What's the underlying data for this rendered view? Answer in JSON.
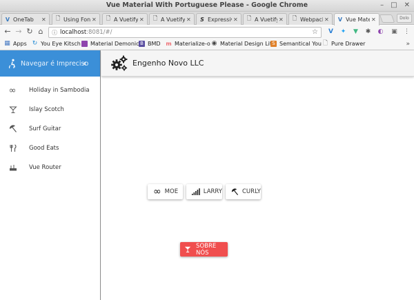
{
  "window": {
    "title": "Vue Material With Portuguese Please - Google Chrome",
    "controls": [
      "–",
      "□",
      "✕"
    ]
  },
  "tabs": [
    {
      "label": "OneTab",
      "icon": "onetab-icon",
      "glyph": "V",
      "color": "#3b7bbf",
      "active": false
    },
    {
      "label": "Using Fon",
      "icon": "page-icon",
      "glyph": "🗋",
      "color": "#666666",
      "active": false
    },
    {
      "label": "A Vuetify T",
      "icon": "page-icon",
      "glyph": "🗋",
      "color": "#666666",
      "active": false
    },
    {
      "label": "A Vuetify T",
      "icon": "page-icon",
      "glyph": "🗋",
      "color": "#666666",
      "active": false
    },
    {
      "label": "Expressiv",
      "icon": "s-logo-icon",
      "glyph": "𝑆",
      "color": "#333333",
      "active": false
    },
    {
      "label": "A Vuetify T",
      "icon": "page-icon",
      "glyph": "🗋",
      "color": "#666666",
      "active": false
    },
    {
      "label": "Webpack",
      "icon": "page-icon",
      "glyph": "🗋",
      "color": "#666666",
      "active": false
    },
    {
      "label": "Vue Mater",
      "icon": "vue-icon",
      "glyph": "V",
      "color": "#3b7bbf",
      "active": true
    }
  ],
  "profile_label": "Dolo",
  "address": {
    "host": "localhost",
    "rest": ":8081/#/"
  },
  "extensions": [
    {
      "name": "vue-devtools-icon",
      "glyph": "V",
      "color": "#2a7fd4"
    },
    {
      "name": "twitter-icon",
      "glyph": "🐦",
      "color": "#1da1f2"
    },
    {
      "name": "vue-logo-icon",
      "glyph": "▼",
      "color": "#41b883"
    },
    {
      "name": "puzzle-icon",
      "glyph": "✱",
      "color": "#555555"
    },
    {
      "name": "palette-icon",
      "glyph": "◐",
      "color": "#8e44ad"
    },
    {
      "name": "reader-icon",
      "glyph": "▣",
      "color": "#666666"
    },
    {
      "name": "menu-icon",
      "glyph": "⋮",
      "color": "#555555"
    }
  ],
  "bookmarks": [
    {
      "label": "Apps",
      "icon": "apps-grid-icon",
      "glyph": "▦",
      "color": "#4a7cc4"
    },
    {
      "label": "You Eye Kitsch",
      "icon": "loop-icon",
      "glyph": "↻",
      "color": "#2a8fd6"
    },
    {
      "label": "Material Demonics",
      "icon": "purple-square-icon",
      "glyph": " ",
      "color": "#8e44ad"
    },
    {
      "label": "BMD",
      "icon": "bmd-logo-icon",
      "glyph": "B",
      "color": "#5a4ea0"
    },
    {
      "label": "Materialize-o",
      "icon": "materialize-icon",
      "glyph": "m",
      "color": "#ee6e73"
    },
    {
      "label": "Material Design Lite",
      "icon": "mdl-logo-icon",
      "glyph": "◉",
      "color": "#444444"
    },
    {
      "label": "Semantical You",
      "icon": "semantic-icon",
      "glyph": "S",
      "color": "#e0812a"
    },
    {
      "label": "Pure Drawer",
      "icon": "page-icon",
      "glyph": "🗋",
      "color": "#777777"
    }
  ],
  "sidebar": {
    "header": "Navegar é Impreciso",
    "items": [
      {
        "label": "Holiday in Sambodia",
        "icon": "infinity-icon",
        "glyph": "∞"
      },
      {
        "label": "Islay Scotch",
        "icon": "cocktail-icon",
        "glyph": "🍸"
      },
      {
        "label": "Surf Guitar",
        "icon": "beach-umbrella-icon",
        "glyph": "⛱"
      },
      {
        "label": "Good Eats",
        "icon": "utensils-icon",
        "glyph": "🍴"
      },
      {
        "label": "Vue Router",
        "icon": "router-icon",
        "glyph": "⌸"
      }
    ]
  },
  "appbar": {
    "title": "Engenho Novo LLC"
  },
  "chips": [
    {
      "label": "MOE",
      "icon": "infinity-icon",
      "glyph": "∞"
    },
    {
      "label": "LARRY",
      "icon": "signal-bars-icon",
      "glyph": "▁▂▃▅"
    },
    {
      "label": "CURLY",
      "icon": "beach-umbrella-icon",
      "glyph": "⛱"
    }
  ],
  "about_button": {
    "label": "SOBRE NÓS",
    "icon": "cocktail-icon",
    "glyph": "🍸",
    "color": "#f04e4e"
  },
  "colors": {
    "sidebar_header": "#3b8fd8",
    "about_button": "#f04e4e"
  }
}
